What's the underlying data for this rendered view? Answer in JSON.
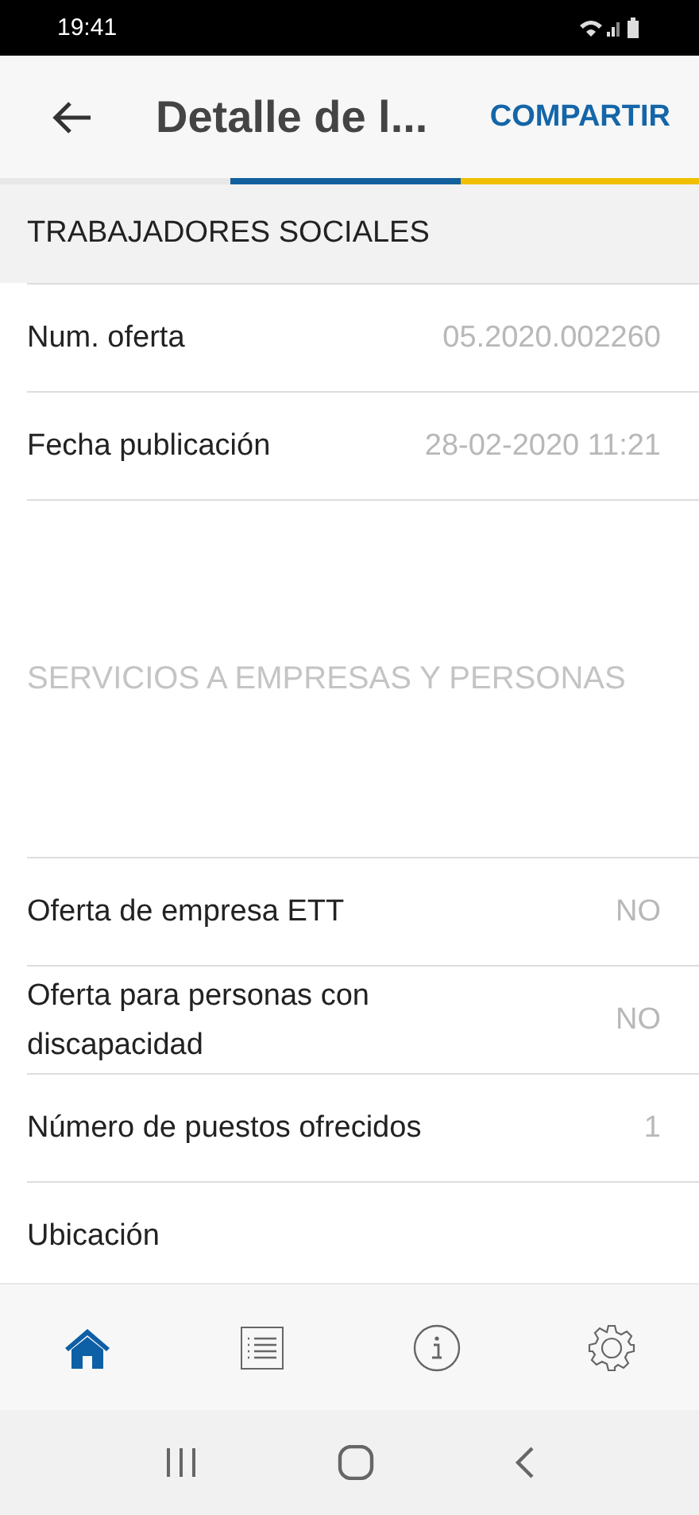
{
  "status_bar": {
    "time": "19:41"
  },
  "header": {
    "title": "Detalle de l...",
    "action": "COMPARTIR"
  },
  "section_title": "TRABAJADORES SOCIALES",
  "fields": [
    {
      "kind": "pair",
      "label": "Num. oferta",
      "value": "05.2020.002260"
    },
    {
      "kind": "pair",
      "label": "Fecha publicación",
      "value": "28-02-2020 11:21"
    },
    {
      "kind": "block",
      "value": "SERVICIOS A EMPRESAS Y PERSONAS"
    },
    {
      "kind": "pair",
      "label": "Oferta de empresa ETT",
      "value": "NO"
    },
    {
      "kind": "pair",
      "label": "Oferta para personas con discapacidad",
      "value": "NO"
    },
    {
      "kind": "pair",
      "label": "Número de puestos ofrecidos",
      "value": "1"
    },
    {
      "kind": "cut",
      "label": "Ubicación"
    }
  ],
  "tabs": [
    {
      "kind": "home",
      "selected": true
    },
    {
      "kind": "list",
      "selected": false
    },
    {
      "kind": "info",
      "selected": false
    },
    {
      "kind": "settings",
      "selected": false
    }
  ]
}
